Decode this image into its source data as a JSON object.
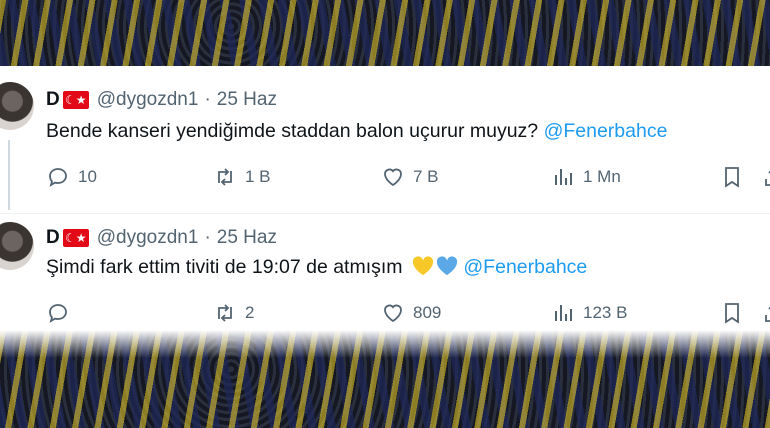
{
  "tweets": [
    {
      "display_name": "D",
      "flag_emoji": "🇹🇷",
      "handle": "@dygozdn1",
      "separator": "·",
      "date": "25 Haz",
      "text": "Bende kanseri yendiğimde staddan balon uçurur muyuz?",
      "mention": "@Fenerbahce",
      "replies": "10",
      "retweets": "1 B",
      "likes": "7 B",
      "views": "1 Mn"
    },
    {
      "display_name": "D",
      "flag_emoji": "🇹🇷",
      "handle": "@dygozdn1",
      "separator": "·",
      "date": "25 Haz",
      "text": "Şimdi fark ettim tiviti de 19:07 de atmışım",
      "hearts": [
        "yellow-heart",
        "blue-heart"
      ],
      "mention": "@Fenerbahce",
      "replies": "",
      "retweets": "2",
      "likes": "809",
      "views": "123 B"
    }
  ],
  "colors": {
    "mention": "#1d9bf0",
    "text": "#0f1419",
    "muted": "#536471",
    "yellow_heart": "#f7c928",
    "blue_heart": "#5aa9e6"
  }
}
